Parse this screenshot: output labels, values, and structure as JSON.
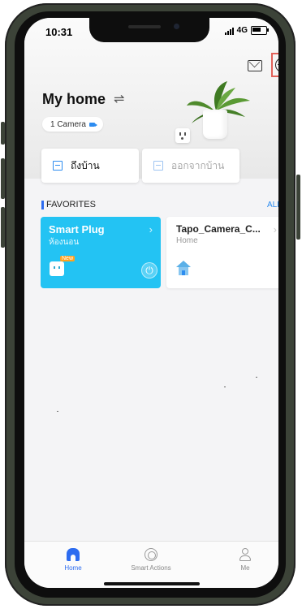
{
  "status_bar": {
    "time": "10:31",
    "network": "4G"
  },
  "header": {
    "home_title": "My home",
    "switch_glyph": "⇌",
    "camera_chip": "1 Camera",
    "icons": [
      "mail-icon",
      "add-icon"
    ],
    "highlight_color": "#e2625a"
  },
  "actions": {
    "arrive_label": "ถึงบ้าน",
    "leave_label": "ออกจากบ้าน"
  },
  "favorites": {
    "title": "FAVORITES",
    "all_label": "ALL",
    "cards": [
      {
        "name": "Smart Plug",
        "room": "ห้องนอน",
        "badge": "New",
        "power": "⏻",
        "color": "#23c3f3"
      },
      {
        "name": "Tapo_Camera_C...",
        "room": "Home"
      }
    ]
  },
  "tabbar": {
    "tabs": [
      {
        "label": "Home",
        "active": true
      },
      {
        "label": "Smart Actions",
        "active": false
      },
      {
        "label": "Me",
        "active": false
      }
    ],
    "accent": "#2d6cf0"
  }
}
